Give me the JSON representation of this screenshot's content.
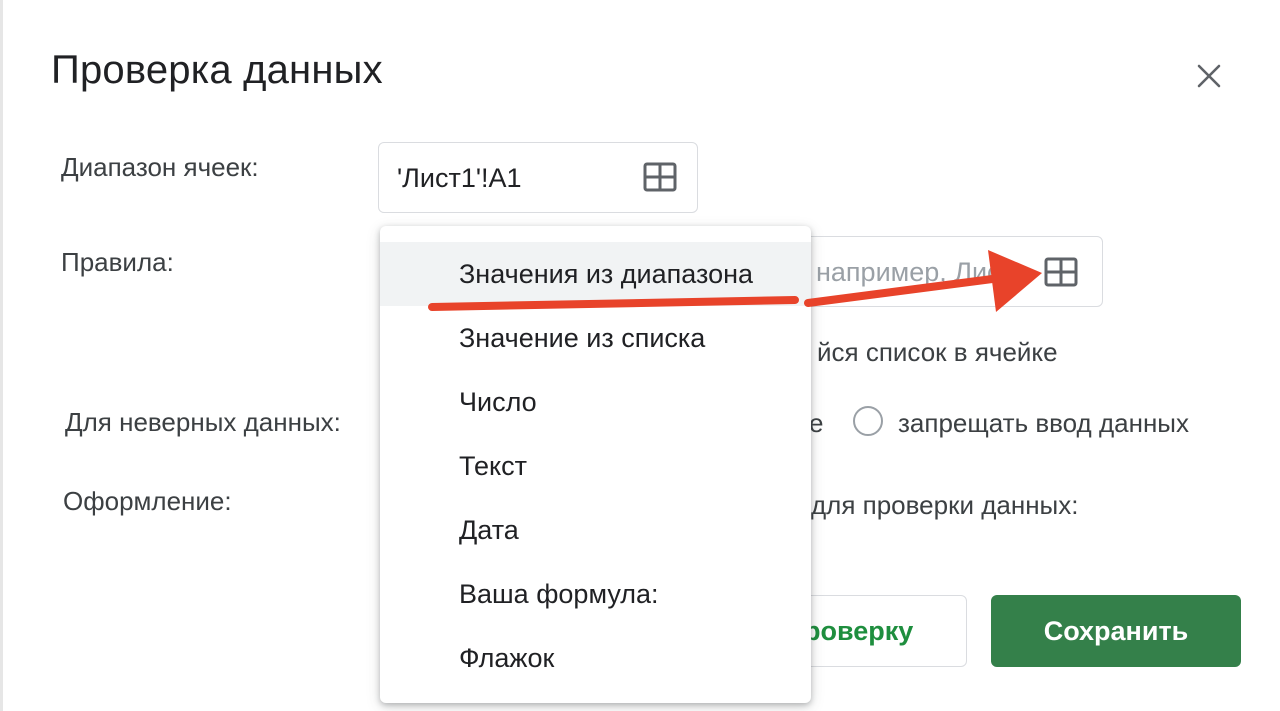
{
  "dialog": {
    "title": "Проверка данных",
    "close_icon": "close-icon"
  },
  "form": {
    "range_label": "Диапазон ячеек:",
    "range_value": "'Лист1'!A1",
    "rules_label": "Правила:",
    "criteria_placeholder": "например, Лист1",
    "show_dropdown_text": "йся список в ячейке",
    "invalid_label": "Для неверных данных:",
    "invalid_option_show_partial": "е",
    "invalid_option_deny": "запрещать ввод данных",
    "appearance_label": "Оформление:",
    "appearance_help_partial": "для проверки данных:"
  },
  "buttons": {
    "remove_partial": "роверку",
    "save": "Сохранить"
  },
  "menu": {
    "items": [
      {
        "label": "Значения из диапазона",
        "highlighted": true
      },
      {
        "label": "Значение из списка"
      },
      {
        "label": "Число"
      },
      {
        "label": "Текст"
      },
      {
        "label": "Дата"
      },
      {
        "label": "Ваша формула:"
      },
      {
        "label": "Флажок"
      }
    ]
  },
  "colors": {
    "accent_green": "#34804a",
    "annotation_red": "#e8432a"
  }
}
